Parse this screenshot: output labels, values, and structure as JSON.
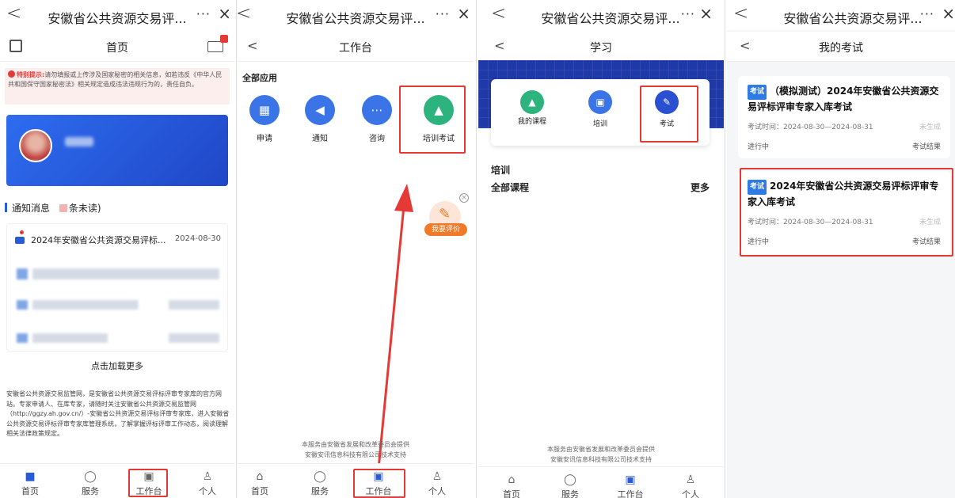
{
  "window_title": "安徽省公共资源交易评...",
  "more_glyph": "···",
  "close_glyph": "×",
  "back_glyph": "<",
  "panel1": {
    "title": "首页",
    "notice_label": "特别提示:",
    "notice_text": "请勿填报或上传涉及国家秘密的相关信息，如若违反《中华人民共和国保守国家秘密法》相关规定造成违法违规行为的，责任自负。",
    "notify_heading": "通知消息",
    "notify_unread": "条未读)",
    "first_notice_title": "2024年安徽省公共资源交易评标...",
    "first_notice_date": "2024-08-30",
    "load_more": "点击加载更多",
    "footer_text": "安徽省公共资源交易监管网，是安徽省公共资源交易评标评审专家库的官方网站。专家申请人、在库专家，请随时关注安徽省公共资源交易监管网（http://ggzy.ah.gov.cn/）-安徽省公共资源交易评标评审专家库，进入安徽省公共资源交易评标评审专家库管理系统，了解掌握评标评审工作动态，阅读理解相关法律政策规定。"
  },
  "panel2": {
    "title": "工作台",
    "section": "全部应用",
    "apps": [
      {
        "label": "申请",
        "icon": "calendar-icon",
        "color": "#3a74e6"
      },
      {
        "label": "通知",
        "icon": "speaker-icon",
        "color": "#3a74e6"
      },
      {
        "label": "咨询",
        "icon": "chat-icon",
        "color": "#3a74e6"
      },
      {
        "label": "培训考试",
        "icon": "graduation-cap-icon",
        "color": "#2db37d"
      }
    ],
    "float_label": "我要评价"
  },
  "panel3": {
    "title": "学习",
    "apps": [
      {
        "label": "我的课程",
        "icon": "graduation-cap-icon",
        "color": "#2db37d"
      },
      {
        "label": "培训",
        "icon": "training-icon",
        "color": "#3a74e6"
      },
      {
        "label": "考试",
        "icon": "pen-icon",
        "color": "#2a4fd0"
      }
    ],
    "section_training": "培训",
    "section_courses": "全部课程",
    "more": "更多"
  },
  "panel4": {
    "title": "我的考试",
    "exams": [
      {
        "tag": "考试",
        "title": "（模拟测试）2024年安徽省公共资源交易评标评审专家入库考试",
        "time": "考试时间：2024-08-30—2024-08-31",
        "state": "未生成",
        "status": "进行中",
        "result": "考试结果"
      },
      {
        "tag": "考试",
        "title": "2024年安徽省公共资源交易评标评审专家入库考试",
        "time": "考试时间：2024-08-30—2024-08-31",
        "state": "未生成",
        "status": "进行中",
        "result": "考试结果"
      }
    ]
  },
  "footer_notice": {
    "line1": "本服务由安徽省发展和改革委员会提供",
    "line2": "安徽安讯信息科技有限公司技术支持"
  },
  "tabs": [
    {
      "label": "首页",
      "icon": "home-icon"
    },
    {
      "label": "服务",
      "icon": "service-icon"
    },
    {
      "label": "工作台",
      "icon": "workbench-icon"
    },
    {
      "label": "个人",
      "icon": "person-icon"
    }
  ],
  "colors": {
    "accent": "#2a5bd7",
    "highlight": "#e53935",
    "banner": "#2b5fe0",
    "notice": "#e53935"
  }
}
